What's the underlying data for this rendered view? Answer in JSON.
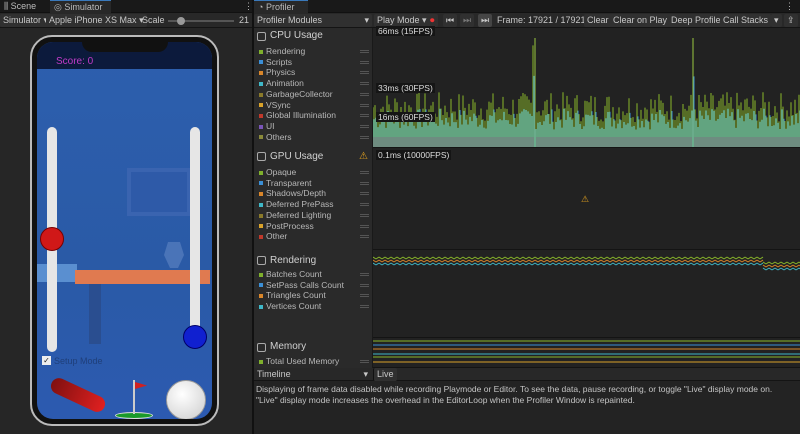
{
  "tabs": {
    "scene": "Scene",
    "simulator": "Simulator",
    "profiler": "Profiler",
    "more": "⋮"
  },
  "sim_toolbar": {
    "mode": "Simulator",
    "device": "Apple iPhone XS Max",
    "scale_label": "Scale",
    "scale_value": "21",
    "scale_fraction": 0.2
  },
  "game": {
    "score": "Score: 0",
    "setup_mode": "Setup Mode",
    "setup_checked": true,
    "left_slider_fraction": 0.5,
    "right_slider_fraction": 0.95
  },
  "profiler_toolbar": {
    "modules": "Profiler Modules",
    "play_mode": "Play Mode",
    "frame": "Frame: 17921 / 17921",
    "clear": "Clear",
    "clear_on_play": "Clear on Play",
    "deep_profile": "Deep Profile",
    "call_stacks": "Call Stacks"
  },
  "cpu": {
    "title": "CPU Usage",
    "items": [
      {
        "label": "Rendering",
        "color": "#7fb02c"
      },
      {
        "label": "Scripts",
        "color": "#3b8fd6"
      },
      {
        "label": "Physics",
        "color": "#d9862a"
      },
      {
        "label": "Animation",
        "color": "#3fb8c8"
      },
      {
        "label": "GarbageCollector",
        "color": "#8a7a2a"
      },
      {
        "label": "VSync",
        "color": "#d9a22a"
      },
      {
        "label": "Global Illumination",
        "color": "#c0392b"
      },
      {
        "label": "UI",
        "color": "#7a55b8"
      },
      {
        "label": "Others",
        "color": "#8a8a3a"
      }
    ],
    "markers": [
      "66ms (15FPS)",
      "33ms (30FPS)",
      "16ms (60FPS)"
    ]
  },
  "gpu": {
    "title": "GPU Usage",
    "marker": "0.1ms (10000FPS)",
    "items": [
      {
        "label": "Opaque",
        "color": "#7fb02c"
      },
      {
        "label": "Transparent",
        "color": "#3b8fd6"
      },
      {
        "label": "Shadows/Depth",
        "color": "#d9862a"
      },
      {
        "label": "Deferred PrePass",
        "color": "#3fb8c8"
      },
      {
        "label": "Deferred Lighting",
        "color": "#8a7a2a"
      },
      {
        "label": "PostProcess",
        "color": "#d9a22a"
      },
      {
        "label": "Other",
        "color": "#c0392b"
      }
    ]
  },
  "rendering": {
    "title": "Rendering",
    "items": [
      {
        "label": "Batches Count",
        "color": "#7fb02c"
      },
      {
        "label": "SetPass Calls Count",
        "color": "#3b8fd6"
      },
      {
        "label": "Triangles Count",
        "color": "#d9862a"
      },
      {
        "label": "Vertices Count",
        "color": "#3fb8c8"
      }
    ]
  },
  "memory": {
    "title": "Memory",
    "items": [
      {
        "label": "Total Used Memory",
        "color": "#7fb02c"
      }
    ]
  },
  "details": {
    "view": "Timeline",
    "live": "Live",
    "message1": "Displaying of frame data disabled while recording Playmode or Editor. To see the data, pause recording, or toggle \"Live\" display mode on.",
    "message2": " \"Live\" display mode increases the overhead in the EditorLoop when the Profiler Window is repainted."
  }
}
